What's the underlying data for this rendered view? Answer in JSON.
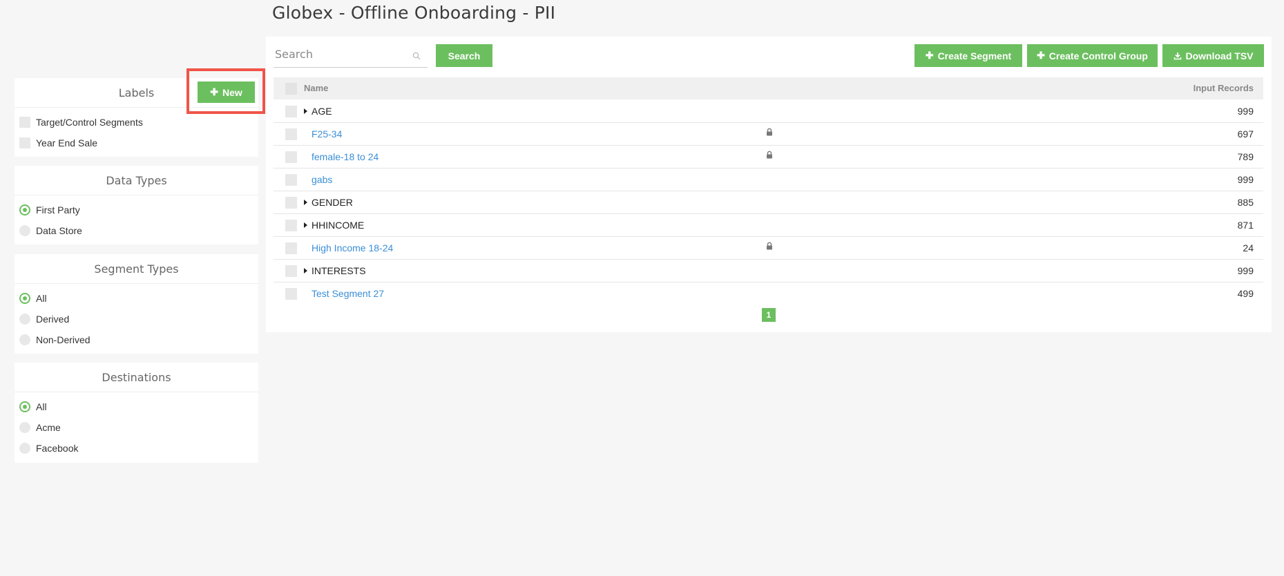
{
  "page_title": "Globex - Offline Onboarding - PII",
  "labels": {
    "title": "Labels",
    "new_button": "New",
    "items": [
      {
        "label": "Target/Control Segments"
      },
      {
        "label": "Year End Sale"
      }
    ]
  },
  "data_types": {
    "title": "Data Types",
    "selected": "First Party",
    "items": [
      {
        "label": "First Party"
      },
      {
        "label": "Data Store"
      }
    ]
  },
  "segment_types": {
    "title": "Segment Types",
    "selected": "All",
    "items": [
      {
        "label": "All"
      },
      {
        "label": "Derived"
      },
      {
        "label": "Non-Derived"
      }
    ]
  },
  "destinations": {
    "title": "Destinations",
    "selected": "All",
    "items": [
      {
        "label": "All"
      },
      {
        "label": "Acme"
      },
      {
        "label": "Facebook"
      }
    ]
  },
  "toolbar": {
    "search_placeholder": "Search",
    "search_button": "Search",
    "create_segment": "Create Segment",
    "create_control_group": "Create Control Group",
    "download_tsv": "Download TSV"
  },
  "table": {
    "columns": [
      "Name",
      "Input Records"
    ],
    "rows": [
      {
        "name": "AGE",
        "records": "999",
        "expandable": true,
        "locked": false
      },
      {
        "name": "F25-34",
        "records": "697",
        "expandable": false,
        "locked": true
      },
      {
        "name": "female-18 to 24",
        "records": "789",
        "expandable": false,
        "locked": true
      },
      {
        "name": "gabs",
        "records": "999",
        "expandable": false,
        "locked": false
      },
      {
        "name": "GENDER",
        "records": "885",
        "expandable": true,
        "locked": false
      },
      {
        "name": "HHINCOME",
        "records": "871",
        "expandable": true,
        "locked": false
      },
      {
        "name": "High Income 18-24",
        "records": "24",
        "expandable": false,
        "locked": true
      },
      {
        "name": "INTERESTS",
        "records": "999",
        "expandable": true,
        "locked": false
      },
      {
        "name": "Test Segment 27",
        "records": "499",
        "expandable": false,
        "locked": false
      }
    ]
  },
  "pagination": {
    "current_page": "1"
  },
  "colors": {
    "accent_green": "#6cbf5f",
    "highlight_red": "#ef5548",
    "link_blue": "#3a8fd6"
  }
}
